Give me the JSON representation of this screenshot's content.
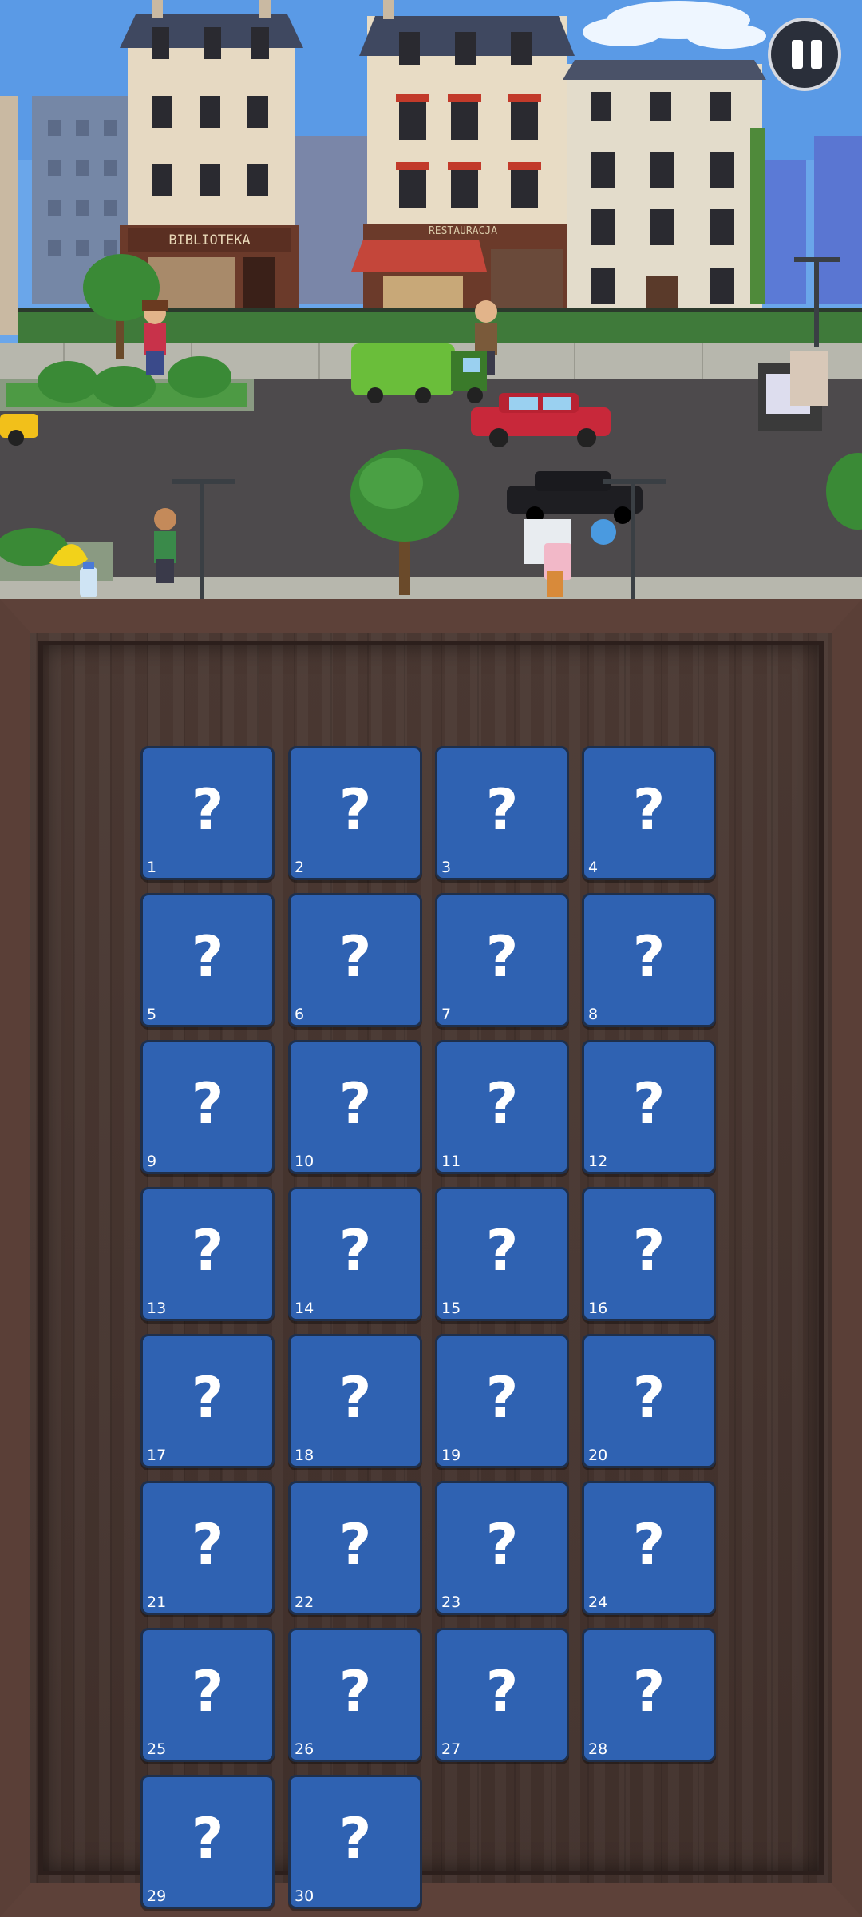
{
  "scene": {
    "signs": {
      "library": "BIBLIOTEKA",
      "restaurant": "RESTAURACJA"
    }
  },
  "pause": {
    "icon": "pause-icon"
  },
  "board": {
    "card_back_symbol": "?",
    "cards": [
      {
        "n": "1"
      },
      {
        "n": "2"
      },
      {
        "n": "3"
      },
      {
        "n": "4"
      },
      {
        "n": "5"
      },
      {
        "n": "6"
      },
      {
        "n": "7"
      },
      {
        "n": "8"
      },
      {
        "n": "9"
      },
      {
        "n": "10"
      },
      {
        "n": "11"
      },
      {
        "n": "12"
      },
      {
        "n": "13"
      },
      {
        "n": "14"
      },
      {
        "n": "15"
      },
      {
        "n": "16"
      },
      {
        "n": "17"
      },
      {
        "n": "18"
      },
      {
        "n": "19"
      },
      {
        "n": "20"
      },
      {
        "n": "21"
      },
      {
        "n": "22"
      },
      {
        "n": "23"
      },
      {
        "n": "24"
      },
      {
        "n": "25"
      },
      {
        "n": "26"
      },
      {
        "n": "27"
      },
      {
        "n": "28"
      },
      {
        "n": "29"
      },
      {
        "n": "30"
      }
    ]
  },
  "colors": {
    "card_face": "#2f62b2",
    "sky": "#4f8fe0",
    "road": "#4d4a4c",
    "sidewalk": "#b6b6ae"
  }
}
